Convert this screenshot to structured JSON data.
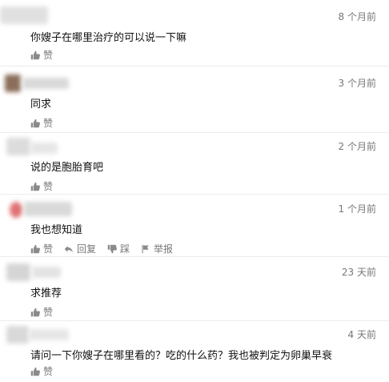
{
  "comments": [
    {
      "time": "8 个月前",
      "text": "你嫂子在哪里治疗的可以说一下嘛",
      "like_label": "赞",
      "avatar_color": "#d8d8d8"
    },
    {
      "time": "3 个月前",
      "text": "同求",
      "like_label": "赞",
      "avatar_color": "#8b6e5a"
    },
    {
      "time": "2 个月前",
      "text": "说的是胞胎育吧",
      "like_label": "赞",
      "avatar_color": "#dcdcdc"
    },
    {
      "time": "1 个月前",
      "text": "我也想知道",
      "like_label": "赞",
      "reply_label": "回复",
      "dislike_label": "踩",
      "report_label": "举报",
      "avatar_color": "#e07272"
    },
    {
      "time": "23 天前",
      "text": "求推荐",
      "like_label": "赞",
      "avatar_color": "#d5d5d5"
    },
    {
      "time": "4 天前",
      "text": "请问一下你嫂子在哪里看的？吃的什么药？我也被判定为卵巢早衰",
      "like_label": "赞",
      "avatar_color": "#d9d9d9"
    }
  ]
}
